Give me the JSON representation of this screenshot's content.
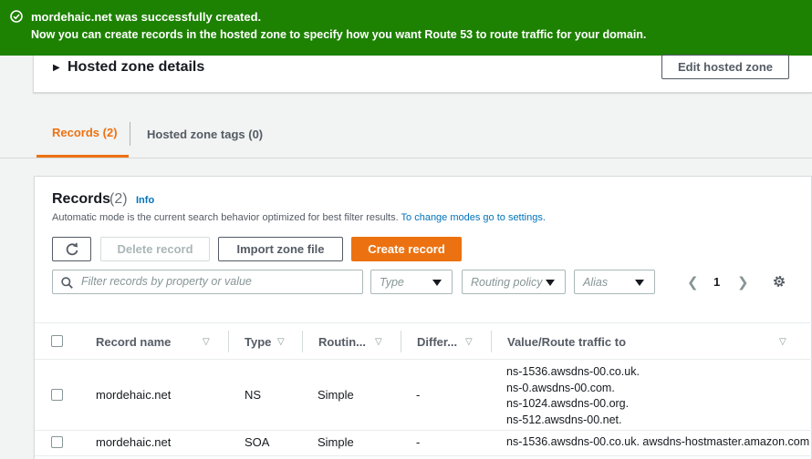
{
  "flash": {
    "title": "mordehaic.net was successfully created.",
    "message": "Now you can create records in the hosted zone to specify how you want Route 53 to route traffic for your domain."
  },
  "hosted_zone_details": {
    "title": "Hosted zone details",
    "edit_button": "Edit hosted zone"
  },
  "tabs": [
    {
      "label": "Records (2)",
      "active": true
    },
    {
      "label": "Hosted zone tags (0)",
      "active": false
    }
  ],
  "records": {
    "title": "Records",
    "count": "(2)",
    "info_link": "Info",
    "description": "Automatic mode is the current search behavior optimized for best filter results.",
    "description_link": "To change modes go to settings.",
    "buttons": {
      "delete": "Delete record",
      "import": "Import zone file",
      "create": "Create record"
    },
    "search_placeholder": "Filter records by property or value",
    "filters": {
      "type": "Type",
      "routing_policy": "Routing policy",
      "alias": "Alias"
    },
    "page": "1"
  },
  "table": {
    "headers": [
      "Record name",
      "Type",
      "Routin...",
      "Differ...",
      "Value/Route traffic to"
    ],
    "rows": [
      {
        "name": "mordehaic.net",
        "type": "NS",
        "routing": "Simple",
        "differ": "-",
        "values": [
          "ns-1536.awsdns-00.co.uk.",
          "ns-0.awsdns-00.com.",
          "ns-1024.awsdns-00.org.",
          "ns-512.awsdns-00.net."
        ]
      },
      {
        "name": "mordehaic.net",
        "type": "SOA",
        "routing": "Simple",
        "differ": "-",
        "values": [
          "ns-1536.awsdns-00.co.uk. awsdns-hostmaster.amazon.com"
        ]
      }
    ]
  },
  "colors": {
    "success": "#1d8102",
    "accent": "#ec7211",
    "link": "#0073bb"
  }
}
